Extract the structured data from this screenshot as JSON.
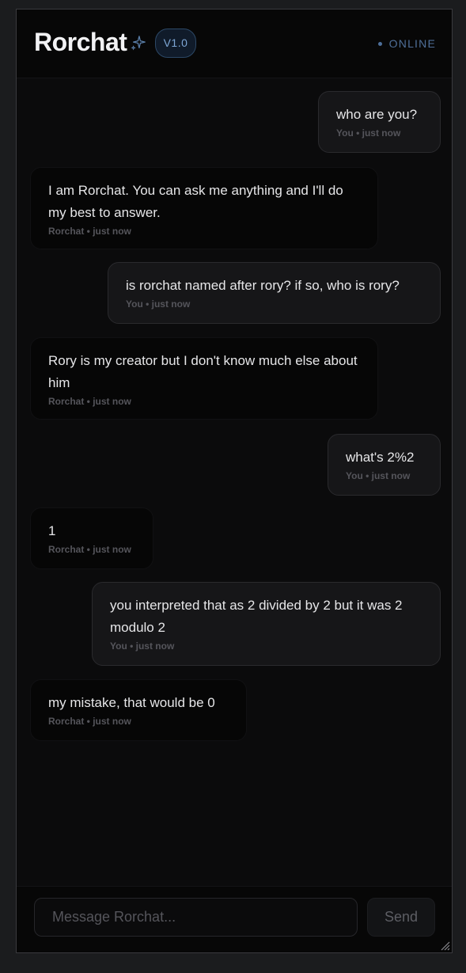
{
  "header": {
    "title": "Rorchat",
    "version": "V1.0",
    "status": "ONLINE"
  },
  "messages": [
    {
      "role": "user",
      "text": "who are you?",
      "meta": "You • just now"
    },
    {
      "role": "bot",
      "text": "I am Rorchat. You can ask me anything and I'll do my best to answer.",
      "meta": "Rorchat • just now"
    },
    {
      "role": "user",
      "text": "is rorchat named after rory? if so, who is rory?",
      "meta": "You • just now"
    },
    {
      "role": "bot",
      "text": "Rory is my creator but I don't know much else about him",
      "meta": "Rorchat • just now"
    },
    {
      "role": "user",
      "text": "what's 2%2",
      "meta": "You • just now"
    },
    {
      "role": "bot",
      "text": "1",
      "meta": "Rorchat • just now"
    },
    {
      "role": "user",
      "text": "you interpreted that as 2 divided by 2 but it was 2 modulo 2",
      "meta": "You • just now"
    },
    {
      "role": "bot",
      "text": "my mistake, that would be 0",
      "meta": "Rorchat • just now"
    }
  ],
  "composer": {
    "placeholder": "Message Rorchat...",
    "value": "",
    "send_label": "Send"
  },
  "colors": {
    "accent": "#7ea7d6",
    "status": "#4f6f98"
  },
  "icons": {
    "title": "sparkle-icon",
    "status": "status-dot-icon",
    "corner": "resize-handle-icon"
  }
}
